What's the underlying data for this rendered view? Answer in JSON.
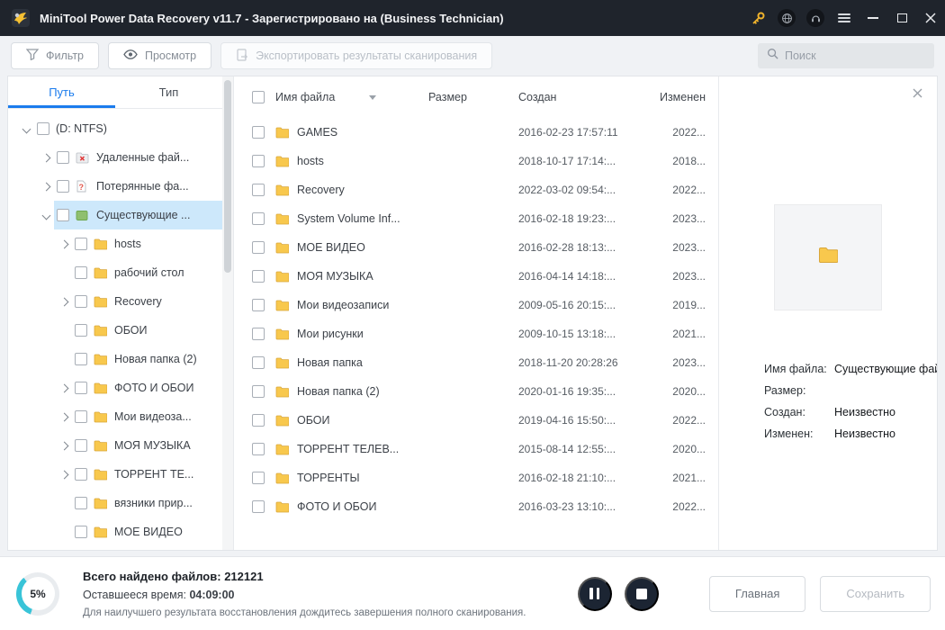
{
  "window": {
    "title": "MiniTool Power Data Recovery v11.7 - Зарегистрировано на (Business Technician)"
  },
  "toolbar": {
    "filter_label": "Фильтр",
    "preview_label": "Просмотр",
    "export_label": "Экспортировать результаты сканирования",
    "search_placeholder": "Поиск"
  },
  "sidebar": {
    "tabs": [
      {
        "label": "Путь",
        "active": true
      },
      {
        "label": "Тип",
        "active": false
      }
    ],
    "tree": [
      {
        "label": "(D: NTFS)",
        "level": 0,
        "expander": "down",
        "icon": "none",
        "selected": false
      },
      {
        "label": "Удаленные фай...",
        "level": 1,
        "expander": "right",
        "icon": "deleted",
        "selected": false
      },
      {
        "label": "Потерянные фа...",
        "level": 1,
        "expander": "right",
        "icon": "lost",
        "selected": false
      },
      {
        "label": "Существующие ...",
        "level": 1,
        "expander": "down",
        "icon": "existing",
        "selected": true
      },
      {
        "label": "hosts",
        "level": 2,
        "expander": "right",
        "icon": "folder",
        "selected": false
      },
      {
        "label": "рабочий стол",
        "level": 2,
        "expander": "none",
        "icon": "folder",
        "selected": false
      },
      {
        "label": "Recovery",
        "level": 2,
        "expander": "right",
        "icon": "folder",
        "selected": false
      },
      {
        "label": "ОБОИ",
        "level": 2,
        "expander": "none",
        "icon": "folder",
        "selected": false
      },
      {
        "label": "Новая папка (2)",
        "level": 2,
        "expander": "none",
        "icon": "folder",
        "selected": false
      },
      {
        "label": "ФОТО И ОБОИ",
        "level": 2,
        "expander": "right",
        "icon": "folder",
        "selected": false
      },
      {
        "label": "Мои видеоза...",
        "level": 2,
        "expander": "right",
        "icon": "folder",
        "selected": false
      },
      {
        "label": "МОЯ МУЗЫКА",
        "level": 2,
        "expander": "right",
        "icon": "folder",
        "selected": false
      },
      {
        "label": "ТОРРЕНТ ТЕ...",
        "level": 2,
        "expander": "right",
        "icon": "folder",
        "selected": false
      },
      {
        "label": "вязники прир...",
        "level": 2,
        "expander": "none",
        "icon": "folder",
        "selected": false
      },
      {
        "label": "МОЕ ВИДЕО",
        "level": 2,
        "expander": "none",
        "icon": "folder",
        "selected": false
      }
    ]
  },
  "filelist": {
    "columns": {
      "name": "Имя файла",
      "size": "Размер",
      "created": "Создан",
      "modified": "Изменен"
    },
    "rows": [
      {
        "name": "GAMES",
        "size": "",
        "created": "2016-02-23 17:57:11",
        "modified": "2022..."
      },
      {
        "name": "hosts",
        "size": "",
        "created": "2018-10-17 17:14:...",
        "modified": "2018..."
      },
      {
        "name": "Recovery",
        "size": "",
        "created": "2022-03-02 09:54:...",
        "modified": "2022..."
      },
      {
        "name": "System Volume Inf...",
        "size": "",
        "created": "2016-02-18 19:23:...",
        "modified": "2023..."
      },
      {
        "name": "МОЕ ВИДЕО",
        "size": "",
        "created": "2016-02-28 18:13:...",
        "modified": "2023..."
      },
      {
        "name": "МОЯ МУЗЫКА",
        "size": "",
        "created": "2016-04-14 14:18:...",
        "modified": "2023..."
      },
      {
        "name": "Мои видеозаписи",
        "size": "",
        "created": "2009-05-16 20:15:...",
        "modified": "2019..."
      },
      {
        "name": "Мои рисунки",
        "size": "",
        "created": "2009-10-15 13:18:...",
        "modified": "2021..."
      },
      {
        "name": "Новая папка",
        "size": "",
        "created": "2018-11-20 20:28:26",
        "modified": "2023..."
      },
      {
        "name": "Новая папка (2)",
        "size": "",
        "created": "2020-01-16 19:35:...",
        "modified": "2020..."
      },
      {
        "name": "ОБОИ",
        "size": "",
        "created": "2019-04-16 15:50:...",
        "modified": "2022..."
      },
      {
        "name": "ТОРРЕНТ ТЕЛЕВ...",
        "size": "",
        "created": "2015-08-14 12:55:...",
        "modified": "2020..."
      },
      {
        "name": "ТОРРЕНТЫ",
        "size": "",
        "created": "2016-02-18 21:10:...",
        "modified": "2021..."
      },
      {
        "name": "ФОТО И ОБОИ",
        "size": "",
        "created": "2016-03-23 13:10:...",
        "modified": "2022..."
      }
    ]
  },
  "preview": {
    "fields": [
      {
        "label": "Имя файла:",
        "value": "Существующие файл"
      },
      {
        "label": "Размер:",
        "value": ""
      },
      {
        "label": "Создан:",
        "value": "Неизвестно"
      },
      {
        "label": "Изменен:",
        "value": "Неизвестно"
      }
    ]
  },
  "statusbar": {
    "progress": "5%",
    "found_label": "Всего найдено файлов:",
    "found_value": "212121",
    "remaining_label": "Оставшееся время:",
    "remaining_value": "04:09:00",
    "hint": "Для наилучшего результата восстановления дождитесь завершения полного сканирования.",
    "home_label": "Главная",
    "save_label": "Сохранить"
  },
  "colors": {
    "titlebar": "#1f242c",
    "accent_blue": "#1b7ced",
    "selection_blue": "#cde8fb",
    "folder_yellow": "#f8c84d",
    "progress_teal": "#39c4d8"
  }
}
